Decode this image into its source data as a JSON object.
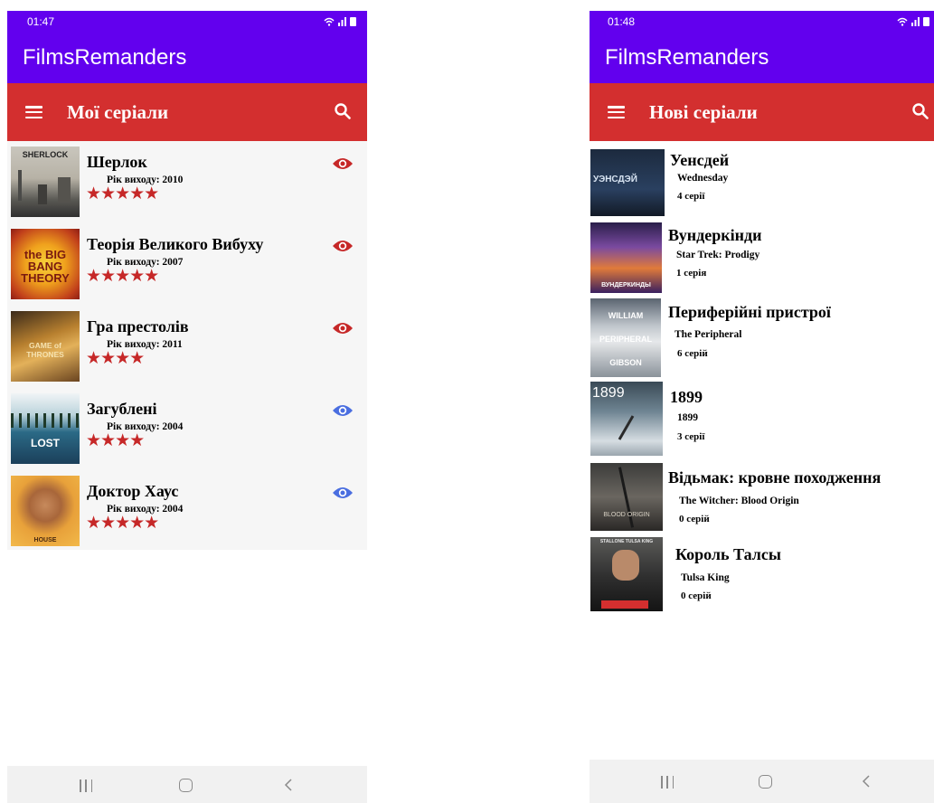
{
  "left_screen": {
    "status_time": "01:47",
    "app_title": "FilmsRemanders",
    "toolbar_title": "Мої серіали",
    "items": [
      {
        "title": "Шерлок",
        "year": "Рік виходу: 2010",
        "stars": "★★★★★",
        "rating": 5,
        "poster_text": "SHERLOCK",
        "watched_state": "watched",
        "eye_color": "#c62828"
      },
      {
        "title": "Теорія Великого Вибуху",
        "year": "Рік виходу: 2007",
        "stars": "★★★★★",
        "rating": 5,
        "poster_text": "the BIG BANG THEORY",
        "watched_state": "watched",
        "eye_color": "#c62828"
      },
      {
        "title": "Гра престолів",
        "year": "Рік виходу: 2011",
        "stars": "★★★★",
        "rating": 4,
        "poster_text": "GAME of THRONES",
        "watched_state": "watched",
        "eye_color": "#c62828"
      },
      {
        "title": "Загублені",
        "year": "Рік виходу: 2004",
        "stars": "★★★★",
        "rating": 4,
        "poster_text": "LOST",
        "watched_state": "not-watched",
        "eye_color": "#4a6ee0"
      },
      {
        "title": "Доктор Хаус",
        "year": "Рік виходу: 2004",
        "stars": "★★★★★",
        "rating": 5,
        "poster_text": "HOUSE",
        "watched_state": "not-watched",
        "eye_color": "#4a6ee0"
      }
    ]
  },
  "right_screen": {
    "status_time": "01:48",
    "app_title": "FilmsRemanders",
    "toolbar_title": "Нові серіали",
    "items": [
      {
        "title": "Уенсдей",
        "original_title": "Wednesday",
        "episodes": "4 серії",
        "poster_text": "УЭНСДЭЙ"
      },
      {
        "title": "Вундеркінди",
        "original_title": "Star Trek: Prodigy",
        "episodes": "1 серія",
        "poster_text": "ВУНДЕРКИНДЫ"
      },
      {
        "title": "Периферійні пристрої",
        "original_title": "The Peripheral",
        "episodes": "6 серій",
        "poster_text": "WILLIAM PERIPHERAL GIBSON"
      },
      {
        "title": "1899",
        "original_title": "1899",
        "episodes": "3 серії",
        "poster_text": "1899"
      },
      {
        "title": "Відьмак: кровне походження",
        "original_title": "The Witcher: Blood Origin",
        "episodes": "0 серій",
        "poster_text": "BLOOD ORIGIN"
      },
      {
        "title": "Король Талсы",
        "original_title": "Tulsa King",
        "episodes": "0 серій",
        "poster_text": "STALLONE TULSA KING"
      }
    ]
  },
  "colors": {
    "status_bar": "#6200ee",
    "app_bar": "#6200ee",
    "toolbar": "#d32f2f",
    "stars": "#c62828",
    "eye_watched": "#c62828",
    "eye_unwatched": "#4a6ee0",
    "nav_bar": "#f1f1f1"
  },
  "icons": {
    "menu": "hamburger-menu-icon",
    "search": "search-icon",
    "watched": "eye-icon",
    "nav_recent": "recent-apps-icon",
    "nav_home": "home-icon",
    "nav_back": "back-icon",
    "status": [
      "wifi-icon",
      "signal-icon",
      "battery-icon"
    ]
  }
}
